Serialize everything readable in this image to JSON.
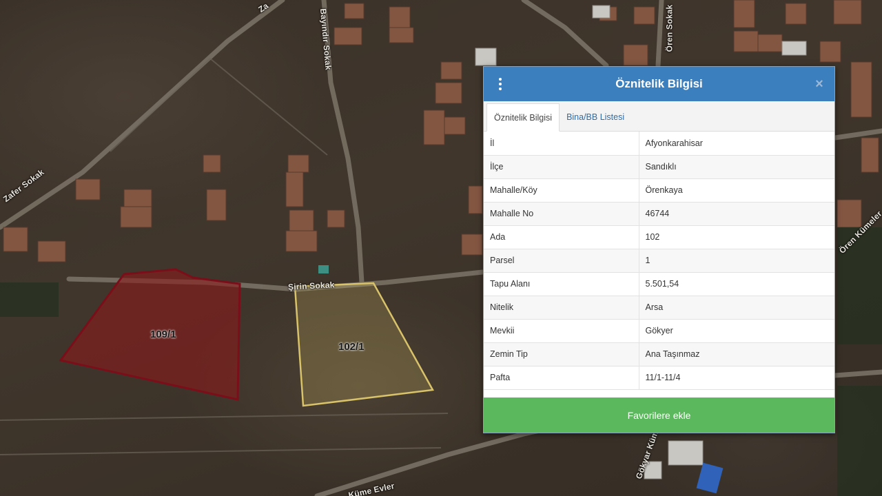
{
  "map": {
    "roads": [
      {
        "id": "zafer",
        "label": "Zafer Sokak"
      },
      {
        "id": "zafer-top",
        "label": "Za"
      },
      {
        "id": "bayindir",
        "label": "Bayındır Sokak"
      },
      {
        "id": "oren",
        "label": "Ören Sokak"
      },
      {
        "id": "sirin",
        "label": "Şirin Sokak"
      },
      {
        "id": "oren-kume",
        "label": "Ören Kümeler"
      },
      {
        "id": "kume-evler",
        "label": "Küme Evler"
      },
      {
        "id": "gokyer-kume",
        "label": "Gökyar Küme"
      }
    ],
    "parcels": [
      {
        "label": "109/1",
        "color": "#8b1a1a"
      },
      {
        "label": "102/1",
        "color": "#d9c36a"
      }
    ]
  },
  "panel": {
    "title": "Öznitelik Bilgisi",
    "menu_icon": "vertical-dots-icon",
    "close_icon": "close-icon",
    "close_glyph": "×",
    "tabs": [
      {
        "label": "Öznitelik Bilgisi",
        "active": true
      },
      {
        "label": "Bina/BB Listesi",
        "active": false
      }
    ],
    "rows": [
      {
        "key": "İl",
        "value": "Afyonkarahisar"
      },
      {
        "key": "İlçe",
        "value": "Sandıklı"
      },
      {
        "key": "Mahalle/Köy",
        "value": "Örenkaya"
      },
      {
        "key": "Mahalle No",
        "value": "46744"
      },
      {
        "key": "Ada",
        "value": "102"
      },
      {
        "key": "Parsel",
        "value": "1"
      },
      {
        "key": "Tapu Alanı",
        "value": "5.501,54"
      },
      {
        "key": "Nitelik",
        "value": "Arsa"
      },
      {
        "key": "Mevkii",
        "value": "Gökyer"
      },
      {
        "key": "Zemin Tip",
        "value": "Ana Taşınmaz"
      },
      {
        "key": "Pafta",
        "value": "11/1-11/4"
      }
    ],
    "favorite_button": "Favorilere ekle",
    "colors": {
      "header": "#3c7fbf",
      "button": "#5cb85c",
      "tab_link": "#2f6ca8"
    }
  }
}
